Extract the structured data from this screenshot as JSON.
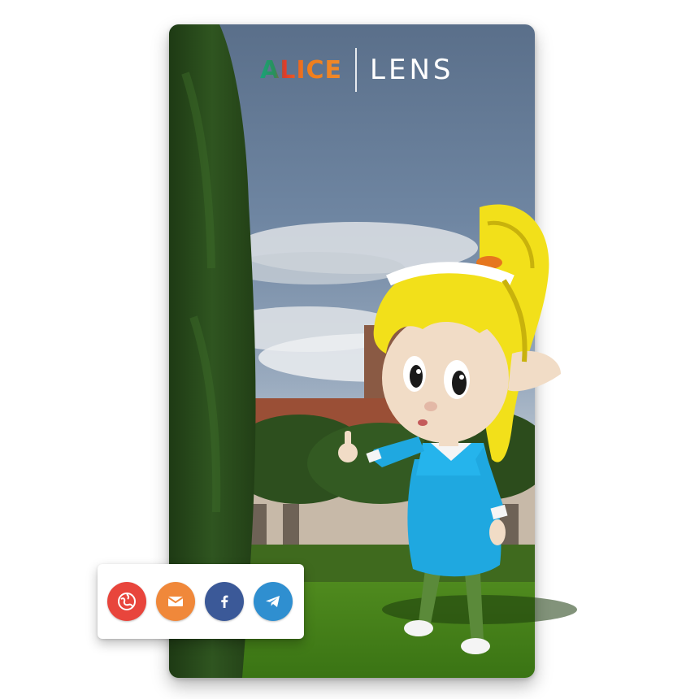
{
  "app": {
    "logo_left": "ALICE",
    "logo_right": "LENS"
  },
  "share": {
    "buttons": [
      {
        "name": "globe",
        "icon": "globe-icon",
        "color": "#e8453c"
      },
      {
        "name": "email",
        "icon": "mail-icon",
        "color": "#f0883a"
      },
      {
        "name": "facebook",
        "icon": "facebook-icon",
        "color": "#3b5998"
      },
      {
        "name": "telegram",
        "icon": "telegram-icon",
        "color": "#2f8fd0"
      }
    ]
  }
}
